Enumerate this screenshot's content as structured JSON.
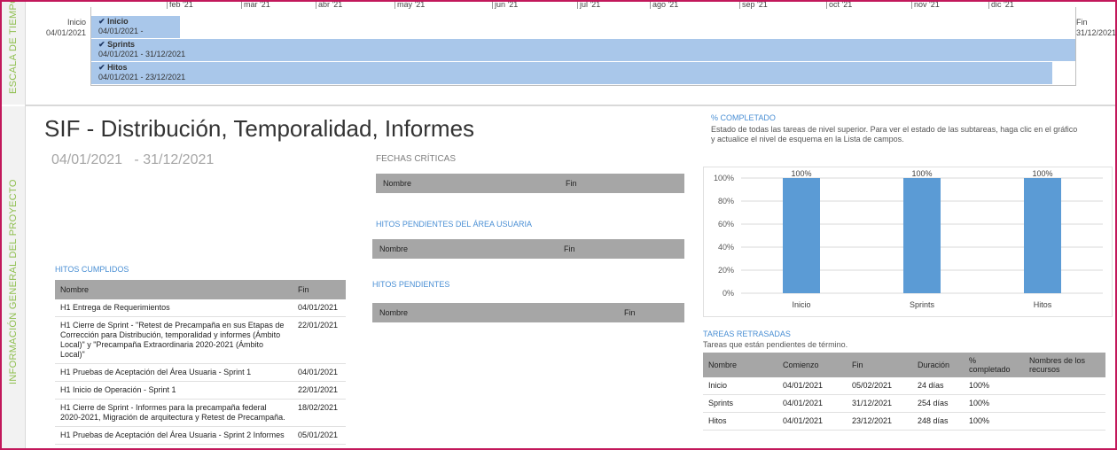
{
  "side": {
    "timeline_label": "ESCALA DE TIEMPO",
    "project_label": "INFORMACIÓN GENERAL DEL PROYECTO"
  },
  "timeline": {
    "start_label": "Inicio",
    "start_date": "04/01/2021",
    "end_label": "Fin",
    "end_date": "31/12/2021",
    "months": [
      "feb '21",
      "mar '21",
      "abr '21",
      "may '21",
      "jun '21",
      "jul '21",
      "ago '21",
      "sep '21",
      "oct '21",
      "nov '21",
      "dic '21"
    ],
    "bars": [
      {
        "name": "Inicio",
        "dates": "04/01/2021 -"
      },
      {
        "name": "Sprints",
        "dates": "04/01/2021 - 31/12/2021"
      },
      {
        "name": "Hitos",
        "dates": "04/01/2021 - 23/12/2021"
      }
    ]
  },
  "project": {
    "title": "SIF - Distribución, Temporalidad, Informes",
    "start": "04/01/2021",
    "end": "- 31/12/2021"
  },
  "hitos_cumplidos": {
    "title": "HITOS CUMPLIDOS",
    "headers": [
      "Nombre",
      "Fin"
    ],
    "rows": [
      [
        "H1 Entrega de Requerimientos",
        "04/01/2021"
      ],
      [
        "H1 Cierre de Sprint - \"Retest de Precampaña en sus Etapas de Corrección para Distribución, temporalidad y informes (Ámbito Local)\" y \"Precampaña Extraordinaria 2020-2021 (Ámbito Local)\"",
        "22/01/2021"
      ],
      [
        "H1 Pruebas de Aceptación del Área Usuaria - Sprint 1",
        "04/01/2021"
      ],
      [
        "H1 Inicio de Operación - Sprint 1",
        "22/01/2021"
      ],
      [
        "H1 Cierre de Sprint - Informes para la precampaña federal 2020-2021, Migración de arquitectura y Retest de Precampaña.",
        "18/02/2021"
      ],
      [
        "H1 Pruebas de Aceptación del Área Usuaria - Sprint 2 Informes",
        "05/01/2021"
      ]
    ]
  },
  "fechas_criticas": {
    "title": "FECHAS CRÍTICAS",
    "col_name": "Nombre",
    "col_end": "Fin"
  },
  "hitos_area": {
    "title": "HITOS PENDIENTES DEL ÁREA USUARIA",
    "col_name": "Nombre",
    "col_end": "Fin"
  },
  "hitos_pendientes": {
    "title": "HITOS PENDIENTES",
    "col_name": "Nombre",
    "col_end": "Fin"
  },
  "completado": {
    "title": "% COMPLETADO",
    "description": "Estado de todas las tareas de nivel superior. Para ver el estado de las subtareas, haga clic en el gráfico y actualice el nivel de esquema en la Lista de campos."
  },
  "chart_data": {
    "type": "bar",
    "categories": [
      "Inicio",
      "Sprints",
      "Hitos"
    ],
    "values": [
      100,
      100,
      100
    ],
    "data_labels": [
      "100%",
      "100%",
      "100%"
    ],
    "yticks": [
      "0%",
      "20%",
      "40%",
      "60%",
      "80%",
      "100%"
    ],
    "ylim": [
      0,
      100
    ],
    "grid": true,
    "color": "#5b9bd5"
  },
  "retrasadas": {
    "title": "TAREAS RETRASADAS",
    "subtitle": "Tareas que están pendientes de término.",
    "headers": [
      "Nombre",
      "Comienzo",
      "Fin",
      "Duración",
      "% completado",
      "Nombres de los recursos"
    ],
    "rows": [
      [
        "Inicio",
        "04/01/2021",
        "05/02/2021",
        "24 días",
        "100%",
        ""
      ],
      [
        "Sprints",
        "04/01/2021",
        "31/12/2021",
        "254 días",
        "100%",
        ""
      ],
      [
        "Hitos",
        "04/01/2021",
        "23/12/2021",
        "248 días",
        "100%",
        ""
      ]
    ]
  }
}
